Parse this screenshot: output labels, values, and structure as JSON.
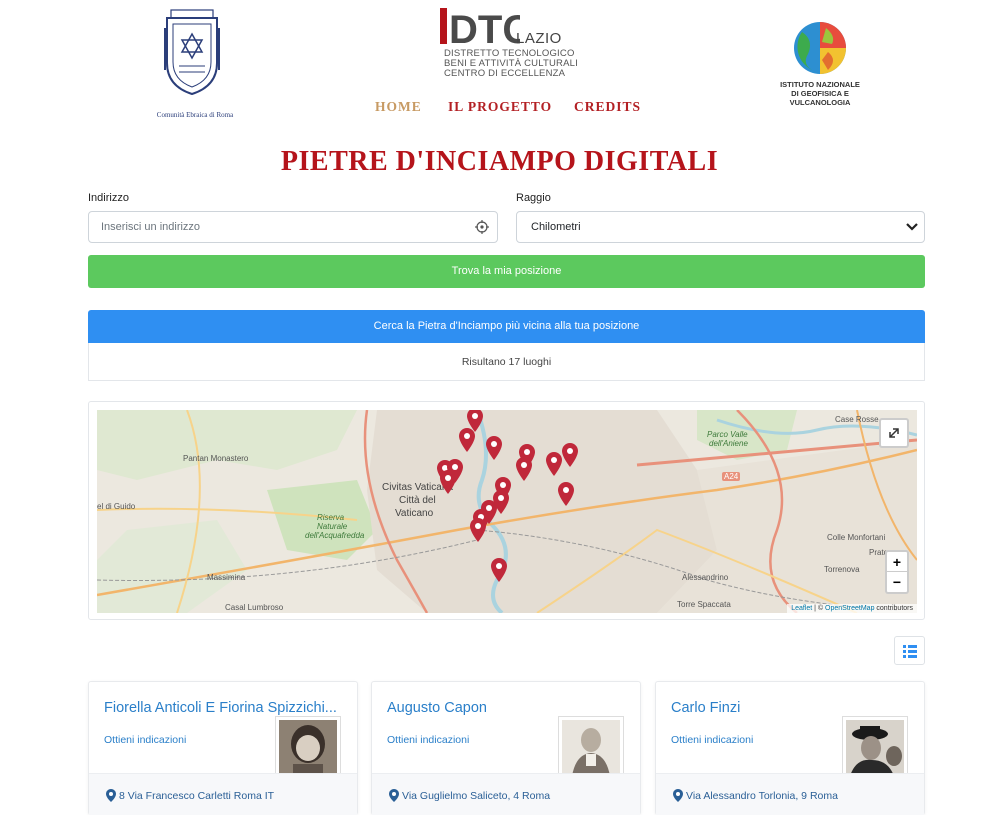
{
  "header": {
    "left_logo_caption": "Comunità Ebraica di Roma",
    "center_logo": {
      "mark": "DTC",
      "region": "LAZIO",
      "lines": [
        "DISTRETTO TECNOLOGICO",
        "BENI E ATTIVITÀ CULTURALI",
        "CENTRO DI ECCELLENZA"
      ]
    },
    "right_logo_caption_1": "ISTITUTO NAZIONALE",
    "right_logo_caption_2": "DI GEOFISICA E VULCANOLOGIA"
  },
  "nav": {
    "home": "HOME",
    "progetto": "IL PROGETTO",
    "credits": "CREDITS"
  },
  "page_title": "PIETRE D'INCIAMPO DIGITALI",
  "form": {
    "address_label": "Indirizzo",
    "address_placeholder": "Inserisci un indirizzo",
    "radius_label": "Raggio",
    "radius_value": "Chilometri",
    "locate_button": "Trova la mia posizione",
    "nearest_button": "Cerca la Pietra d'Inciampo più vicina alla tua posizione",
    "results_text": "Risultano 17 luoghi"
  },
  "map": {
    "labels": {
      "civitas1": "Civitas Vaticana",
      "civitas2": "Città del",
      "civitas3": "Vaticano",
      "pantan": "Pantan Monastero",
      "guido": "el di Guido",
      "massimina": "Massimina",
      "lumbroso": "Casal Lumbroso",
      "riserva1": "Riserva",
      "riserva2": "Naturale",
      "riserva3": "dell'Acquafredda",
      "parco1": "Parco Valle",
      "parco2": "dell'Aniene",
      "case_rosse": "Case Rosse",
      "alessandrino": "Alessandrino",
      "torre_spaccata": "Torre Spaccata",
      "colle": "Colle Monfortani",
      "torrenova": "Torrenova",
      "prato": "Prato",
      "road_a24": "A24"
    },
    "zoom_in": "+",
    "zoom_out": "−",
    "attribution_leaflet": "Leaflet",
    "attribution_sep": " | © ",
    "attribution_osm": "OpenStreetMap",
    "attribution_tail": " contributors",
    "marker_color": "#c0283a"
  },
  "cards": [
    {
      "name": "Fiorella Anticoli E Fiorina Spizzichi...",
      "directions": "Ottieni indicazioni",
      "address": "8 Via Francesco Carletti Roma IT"
    },
    {
      "name": "Augusto Capon",
      "directions": "Ottieni indicazioni",
      "address": "Via Guglielmo Saliceto, 4 Roma"
    },
    {
      "name": "Carlo Finzi",
      "directions": "Ottieni indicazioni",
      "address": "Via Alessandro Torlonia, 9 Roma"
    }
  ],
  "colors": {
    "title": "#b5141b",
    "nav_active": "#c79a63",
    "nav": "#b32024",
    "green_button": "#5cc95e",
    "blue_button": "#2f8ff2",
    "link": "#2a7fc9"
  }
}
